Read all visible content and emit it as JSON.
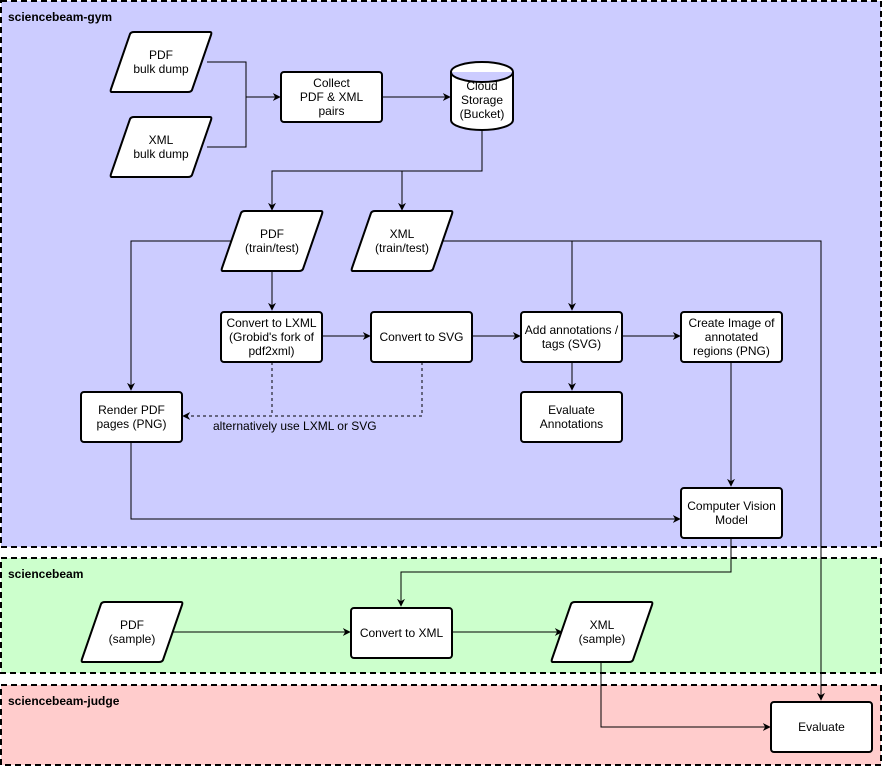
{
  "colors": {
    "lane_gym": "#ccccff",
    "lane_sciencebeam": "#ccffcc",
    "lane_judge": "#ffcccc",
    "node_fill": "#ffffff",
    "stroke": "#000000"
  },
  "lanes": [
    {
      "id": "gym",
      "label": "sciencebeam-gym"
    },
    {
      "id": "sciencebeam",
      "label": "sciencebeam"
    },
    {
      "id": "judge",
      "label": "sciencebeam-judge"
    }
  ],
  "nodes": {
    "pdf_bulk": {
      "shape": "data",
      "lines": [
        "PDF",
        "bulk dump"
      ]
    },
    "xml_bulk": {
      "shape": "data",
      "lines": [
        "XML",
        "bulk dump"
      ]
    },
    "collect": {
      "shape": "process",
      "lines": [
        "Collect",
        "PDF & XML",
        "pairs"
      ]
    },
    "cloud": {
      "shape": "database",
      "lines": [
        "Cloud",
        "Storage",
        "(Bucket)"
      ]
    },
    "pdf_train": {
      "shape": "data",
      "lines": [
        "PDF",
        "(train/test)"
      ]
    },
    "xml_train": {
      "shape": "data",
      "lines": [
        "XML",
        "(train/test)"
      ]
    },
    "convert_lxml": {
      "shape": "process",
      "lines": [
        "Convert to LXML",
        "(Grobid's fork of",
        "pdf2xml)"
      ]
    },
    "convert_svg": {
      "shape": "process",
      "lines": [
        "Convert to SVG"
      ]
    },
    "add_annotations": {
      "shape": "process",
      "lines": [
        "Add annotations /",
        "tags (SVG)"
      ]
    },
    "create_image": {
      "shape": "process",
      "lines": [
        "Create Image of",
        "annotated",
        "regions (PNG)"
      ]
    },
    "render_pdf": {
      "shape": "process",
      "lines": [
        "Render PDF",
        "pages (PNG)"
      ]
    },
    "evaluate_annotations": {
      "shape": "process",
      "lines": [
        "Evaluate",
        "Annotations"
      ]
    },
    "cv_model": {
      "shape": "process",
      "lines": [
        "Computer Vision",
        "Model"
      ]
    },
    "pdf_sample": {
      "shape": "data",
      "lines": [
        "PDF",
        "(sample)"
      ]
    },
    "convert_xml": {
      "shape": "process",
      "lines": [
        "Convert to XML"
      ]
    },
    "xml_sample": {
      "shape": "data",
      "lines": [
        "XML",
        "(sample)"
      ]
    },
    "evaluate": {
      "shape": "process",
      "lines": [
        "Evaluate"
      ]
    }
  },
  "edges": [
    {
      "from": "pdf_bulk",
      "to": "collect",
      "style": "solid"
    },
    {
      "from": "xml_bulk",
      "to": "collect",
      "style": "solid"
    },
    {
      "from": "collect",
      "to": "cloud",
      "style": "solid"
    },
    {
      "from": "cloud",
      "to": "pdf_train",
      "style": "solid"
    },
    {
      "from": "cloud",
      "to": "xml_train",
      "style": "solid"
    },
    {
      "from": "pdf_train",
      "to": "render_pdf",
      "style": "solid"
    },
    {
      "from": "pdf_train",
      "to": "convert_lxml",
      "style": "solid"
    },
    {
      "from": "xml_train",
      "to": "add_annotations",
      "style": "solid"
    },
    {
      "from": "xml_train",
      "to": "evaluate",
      "style": "solid"
    },
    {
      "from": "convert_lxml",
      "to": "convert_svg",
      "style": "solid"
    },
    {
      "from": "convert_svg",
      "to": "add_annotations",
      "style": "solid"
    },
    {
      "from": "add_annotations",
      "to": "create_image",
      "style": "solid"
    },
    {
      "from": "add_annotations",
      "to": "evaluate_annotations",
      "style": "solid"
    },
    {
      "from": "convert_lxml",
      "to": "render_pdf",
      "style": "dashed"
    },
    {
      "from": "convert_svg",
      "to": "render_pdf",
      "style": "dashed",
      "label": "alternatively use LXML or SVG"
    },
    {
      "from": "create_image",
      "to": "cv_model",
      "style": "solid"
    },
    {
      "from": "render_pdf",
      "to": "cv_model",
      "style": "solid"
    },
    {
      "from": "cv_model",
      "to": "convert_xml",
      "style": "solid"
    },
    {
      "from": "pdf_sample",
      "to": "convert_xml",
      "style": "solid"
    },
    {
      "from": "convert_xml",
      "to": "xml_sample",
      "style": "solid"
    },
    {
      "from": "xml_sample",
      "to": "evaluate",
      "style": "solid"
    }
  ],
  "edge_label_alt": "alternatively use LXML or SVG"
}
